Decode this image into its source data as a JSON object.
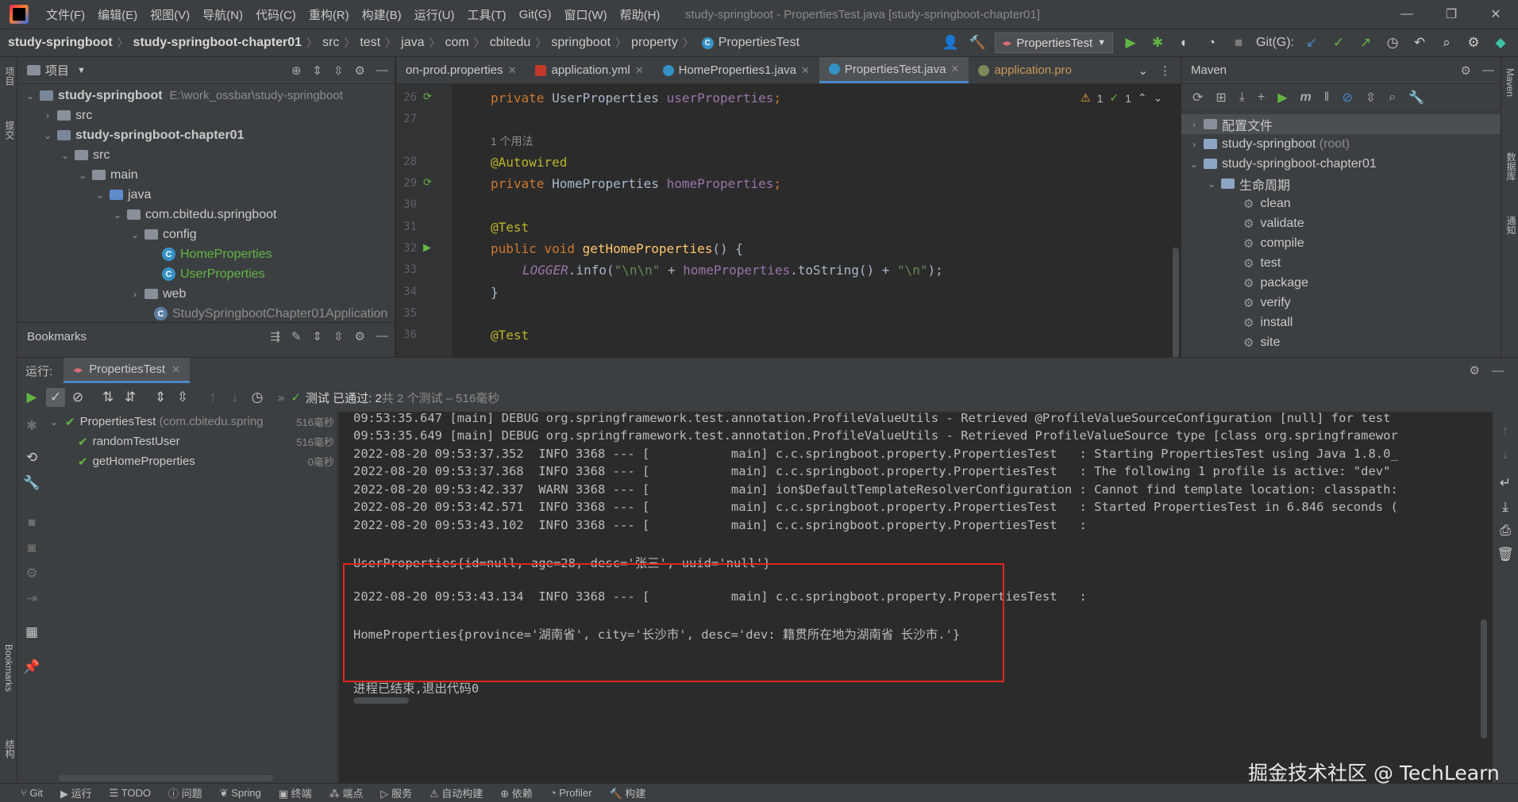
{
  "menubar": {
    "items": [
      "文件(F)",
      "编辑(E)",
      "视图(V)",
      "导航(N)",
      "代码(C)",
      "重构(R)",
      "构建(B)",
      "运行(U)",
      "工具(T)",
      "Git(G)",
      "窗口(W)",
      "帮助(H)"
    ],
    "window_title": "study-springboot - PropertiesTest.java [study-springboot-chapter01]",
    "minimize": "—",
    "maximize": "❐",
    "close": "✕"
  },
  "navbar": {
    "crumbs": [
      "study-springboot",
      "study-springboot-chapter01",
      "src",
      "test",
      "java",
      "com",
      "cbitedu",
      "springboot",
      "property",
      "PropertiesTest"
    ],
    "run_config": "PropertiesTest",
    "git_label": "Git(G):"
  },
  "leftstripe": {
    "project": "项目",
    "commit": "提交",
    "bookmarks": "Bookmarks",
    "structure": "结构"
  },
  "rightstripe": {
    "maven": "Maven",
    "database": "数据库",
    "notifications": "通知"
  },
  "project": {
    "title": "项目",
    "tree": [
      {
        "label": "study-springboot",
        "hint": "E:\\work_ossbar\\study-springboot"
      },
      {
        "label": "src"
      },
      {
        "label": "study-springboot-chapter01"
      },
      {
        "label": "src"
      },
      {
        "label": "main"
      },
      {
        "label": "java"
      },
      {
        "label": "com.cbitedu.springboot"
      },
      {
        "label": "config"
      },
      {
        "label": "HomeProperties"
      },
      {
        "label": "UserProperties"
      },
      {
        "label": "web"
      },
      {
        "label": "StudySpringbootChapter01Application"
      }
    ]
  },
  "bookmarks": {
    "title": "Bookmarks"
  },
  "editor": {
    "tabs": [
      {
        "label": "on-prod.properties"
      },
      {
        "label": "application.yml"
      },
      {
        "label": "HomeProperties1.java"
      },
      {
        "label": "PropertiesTest.java"
      },
      {
        "label": "application.pro"
      }
    ],
    "inspections": {
      "warnings": "1",
      "ok": "1"
    },
    "line_numbers": [
      "26",
      "27",
      "28",
      "29",
      "30",
      "31",
      "32",
      "33",
      "34",
      "35",
      "36"
    ],
    "usage_hint": "1 个用法",
    "code": {
      "l26_kw": "private ",
      "l26_type": "UserProperties ",
      "l26_field": "userProperties",
      "l26_end": ";",
      "l28": "@Autowired",
      "l29_kw": "private ",
      "l29_type": "HomeProperties ",
      "l29_field": "homeProperties",
      "l29_end": ";",
      "l31": "@Test",
      "l32_kw": "public void ",
      "l32_fn": "getHomeProperties",
      "l32_end": "() {",
      "l33_logger": "LOGGER",
      "l33_mid": ".info(",
      "l33_str1": "\"\\n\\n\"",
      "l33_plus": " + ",
      "l33_field": "homeProperties",
      "l33_call": ".toString() + ",
      "l33_str2": "\"\\n\"",
      "l33_end": ");",
      "l34": "}",
      "l36": "@Test"
    }
  },
  "maven": {
    "title": "Maven",
    "tree": [
      {
        "label": "配置文件"
      },
      {
        "label": "study-springboot",
        "hint": "(root)"
      },
      {
        "label": "study-springboot-chapter01"
      },
      {
        "label": "生命周期"
      }
    ],
    "lifecycle": [
      "clean",
      "validate",
      "compile",
      "test",
      "package",
      "verify",
      "install",
      "site"
    ]
  },
  "run": {
    "label": "运行:",
    "tab": "PropertiesTest",
    "status_prefix": "测试 已通过: ",
    "status_count": "2",
    "status_suffix": "共 2 个测试 – 516毫秒",
    "tests": [
      {
        "name": "PropertiesTest",
        "hint": "(com.cbitedu.spring",
        "time": "516毫秒"
      },
      {
        "name": "randomTestUser",
        "time": "516毫秒"
      },
      {
        "name": "getHomeProperties",
        "time": "0毫秒"
      }
    ]
  },
  "console": {
    "lines": [
      "09:53:35.647 [main] DEBUG org.springframework.test.annotation.ProfileValueUtils - Retrieved @ProfileValueSourceConfiguration [null] for test",
      "09:53:35.649 [main] DEBUG org.springframework.test.annotation.ProfileValueUtils - Retrieved ProfileValueSource type [class org.springframewor",
      "2022-08-20 09:53:37.352  INFO 3368 --- [           main] c.c.springboot.property.PropertiesTest   : Starting PropertiesTest using Java 1.8.0_",
      "2022-08-20 09:53:37.368  INFO 3368 --- [           main] c.c.springboot.property.PropertiesTest   : The following 1 profile is active: \"dev\"",
      "2022-08-20 09:53:42.337  WARN 3368 --- [           main] ion$DefaultTemplateResolverConfiguration : Cannot find template location: classpath:",
      "2022-08-20 09:53:42.571  INFO 3368 --- [           main] c.c.springboot.property.PropertiesTest   : Started PropertiesTest in 6.846 seconds (",
      "2022-08-20 09:53:43.102  INFO 3368 --- [           main] c.c.springboot.property.PropertiesTest   :",
      "UserProperties{id=null, age=28, desc='张三', uuid='null'}",
      "2022-08-20 09:53:43.134  INFO 3368 --- [           main] c.c.springboot.property.PropertiesTest   :",
      "HomeProperties{province='湖南省', city='长沙市', desc='dev: 籍贯所在地为湖南省 长沙市.'}",
      "进程已结束,退出代码0"
    ]
  },
  "statusbar": {
    "items": [
      "Git",
      "运行",
      "TODO",
      "问题",
      "Spring",
      "终端",
      "端点",
      "服务",
      "自动构建",
      "依赖",
      "Profiler",
      "构建"
    ]
  },
  "watermark": "掘金技术社区 @ TechLearn",
  "colors": {
    "background": "#2b2b2b",
    "panel": "#3c3f41",
    "accent": "#4a88c7",
    "highlight_box": "#e0261b",
    "pass_green": "#62b543"
  }
}
